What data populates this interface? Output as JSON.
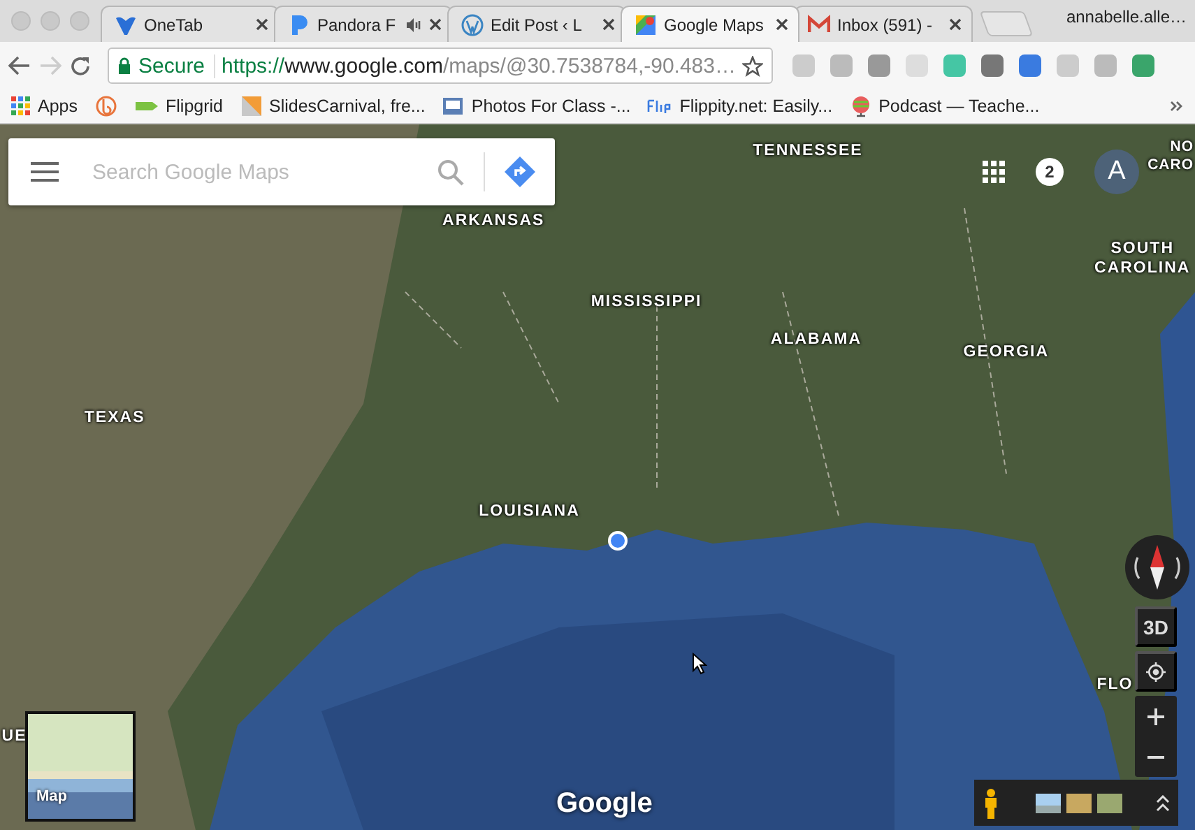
{
  "tabs": [
    {
      "title": "OneTab",
      "selected": false,
      "audio": false
    },
    {
      "title": "Pandora F",
      "selected": false,
      "audio": true
    },
    {
      "title": "Edit Post ‹ L",
      "selected": false,
      "audio": false
    },
    {
      "title": "Google Maps",
      "selected": true,
      "audio": false
    },
    {
      "title": "Inbox (591) -",
      "selected": false,
      "audio": false
    }
  ],
  "profile": "annabelle.alle…",
  "address_bar": {
    "security": "Secure",
    "scheme": "https://",
    "host": "www.google.com",
    "path": "/maps/@30.7538784,-90.483…"
  },
  "bookmarks": [
    {
      "kind": "link",
      "label": "Apps"
    },
    {
      "kind": "icon"
    },
    {
      "kind": "link",
      "label": "Flipgrid"
    },
    {
      "kind": "link",
      "label": "SlidesCarnival, fre..."
    },
    {
      "kind": "link",
      "label": "Photos For Class -..."
    },
    {
      "kind": "link",
      "label": "Flippity.net: Easily..."
    },
    {
      "kind": "link",
      "label": "Podcast — Teache..."
    }
  ],
  "map": {
    "search": {
      "placeholder": "Search Google Maps"
    },
    "notifications": "2",
    "avatar": "A",
    "labels": [
      "TENNESSEE",
      "NO CARO",
      "ARKANSAS",
      "SOUTH CAROLINA",
      "MISSISSIPPI",
      "ALABAMA",
      "GEORGIA",
      "TEXAS",
      "LOUISIANA",
      "FLO",
      "UE"
    ],
    "view_3d": "3D",
    "minimap_label": "Map",
    "logo": "Google"
  }
}
